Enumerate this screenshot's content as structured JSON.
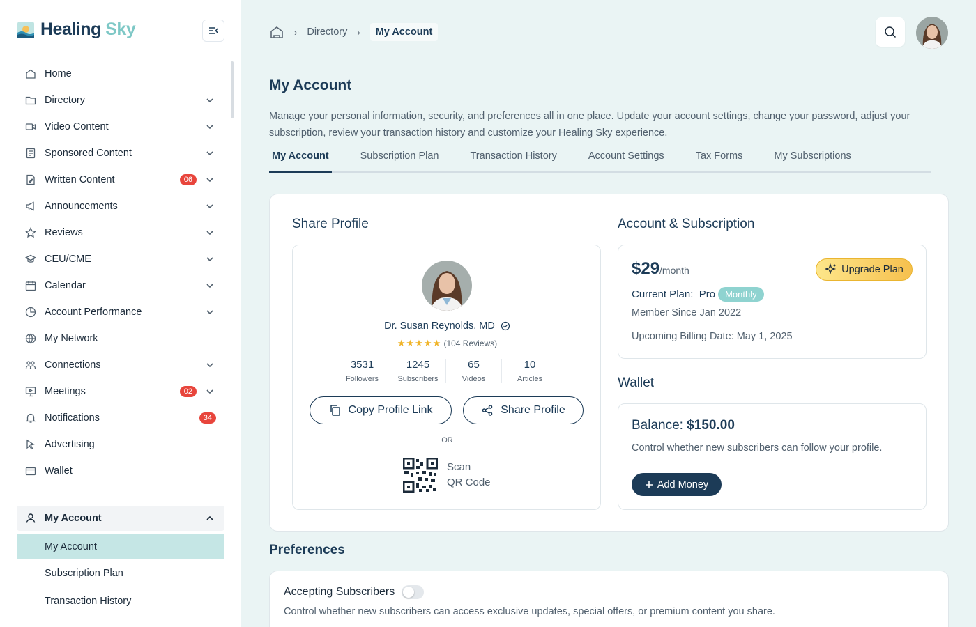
{
  "brand": {
    "name_primary": "Healing",
    "name_secondary": "Sky"
  },
  "sidebar": {
    "items": [
      {
        "label": "Home",
        "icon": "home-icon"
      },
      {
        "label": "Directory",
        "icon": "folder-icon",
        "expandable": true
      },
      {
        "label": "Video Content",
        "icon": "video-icon",
        "expandable": true
      },
      {
        "label": "Sponsored Content",
        "icon": "document-icon",
        "expandable": true
      },
      {
        "label": "Written Content",
        "icon": "pen-file-icon",
        "expandable": true,
        "badge": "06"
      },
      {
        "label": "Announcements",
        "icon": "megaphone-icon",
        "expandable": true
      },
      {
        "label": "Reviews",
        "icon": "star-icon",
        "expandable": true
      },
      {
        "label": "CEU/CME",
        "icon": "graduation-cap-icon",
        "expandable": true
      },
      {
        "label": "Calendar",
        "icon": "calendar-icon",
        "expandable": true
      },
      {
        "label": "Account Performance",
        "icon": "pie-chart-icon",
        "expandable": true
      },
      {
        "label": "My Network",
        "icon": "globe-icon"
      },
      {
        "label": "Connections",
        "icon": "users-icon",
        "expandable": true
      },
      {
        "label": "Meetings",
        "icon": "presentation-icon",
        "expandable": true,
        "badge": "02"
      },
      {
        "label": "Notifications",
        "icon": "bell-icon",
        "badge": "34"
      },
      {
        "label": "Advertising",
        "icon": "cursor-icon"
      },
      {
        "label": "Wallet",
        "icon": "wallet-icon"
      }
    ],
    "account_group": {
      "label": "My Account",
      "subitems": [
        "My Account",
        "Subscription Plan",
        "Transaction History"
      ]
    }
  },
  "breadcrumb": {
    "items": [
      "Directory",
      "My Account"
    ]
  },
  "page": {
    "title": "My Account",
    "description": "Manage your personal information, security, and preferences all in one place. Update your account settings, change your password, adjust your subscription, review your transaction history and customize your Healing Sky experience."
  },
  "tabs": [
    "My Account",
    "Subscription Plan",
    "Transaction History",
    "Account Settings",
    "Tax Forms",
    "My Subscriptions"
  ],
  "share_profile": {
    "title": "Share Profile",
    "name": "Dr. Susan Reynolds, MD",
    "stars": "★★★★★",
    "reviews": "(104 Reviews)",
    "stats": [
      {
        "value": "3531",
        "label": "Followers"
      },
      {
        "value": "1245",
        "label": "Subscribers"
      },
      {
        "value": "65",
        "label": "Videos"
      },
      {
        "value": "10",
        "label": "Articles"
      }
    ],
    "copy_button": "Copy Profile Link",
    "share_button": "Share Profile",
    "or_text": "OR",
    "scan_line1": "Scan",
    "scan_line2": "QR Code"
  },
  "subscription": {
    "title": "Account & Subscription",
    "price": "$29",
    "period": "/month",
    "upgrade_button": "Upgrade Plan",
    "plan_label": "Current Plan:",
    "plan_name": "Pro",
    "plan_cycle": "Monthly",
    "member_since": "Member Since Jan 2022",
    "billing_date": "Upcoming Billing Date: May 1, 2025"
  },
  "wallet": {
    "title": "Wallet",
    "balance_label": "Balance:",
    "balance_value": "$150.00",
    "description": "Control whether new subscribers can follow your profile.",
    "add_button": "Add Money"
  },
  "preferences": {
    "title": "Preferences",
    "accepting_label": "Accepting Subscribers",
    "accepting_desc": "Control whether new subscribers can access exclusive updates, special offers, or premium content you share."
  },
  "colors": {
    "primary": "#1c3b57",
    "accent": "#7ec8c6",
    "active_bg": "#c5e6e5",
    "badge": "#e8453c",
    "background": "#eaf4f4"
  }
}
